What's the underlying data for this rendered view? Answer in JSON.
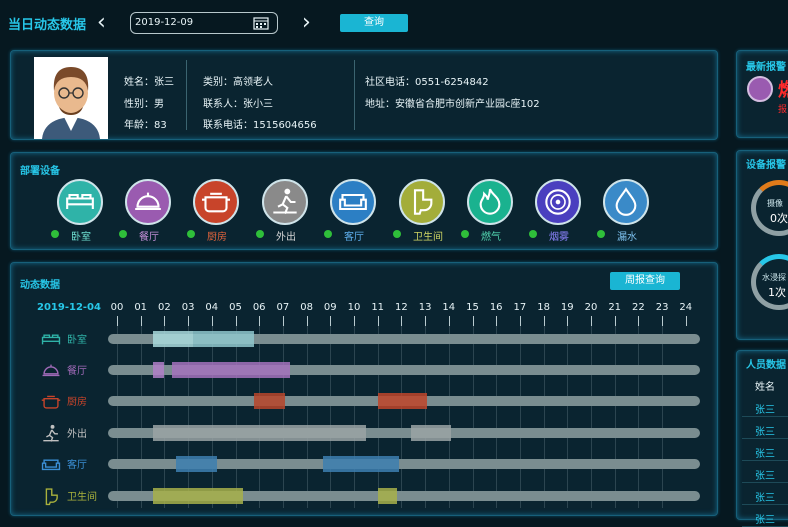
{
  "header": {
    "title": "当日动态数据",
    "date": "2019-12-09",
    "query": "查询"
  },
  "profile": {
    "name": "姓名：张三",
    "gender": "性别：男",
    "age": "年龄：83",
    "category": "类别：高领老人",
    "contact": "联系人：张小三",
    "contact_phone": "联系电话：1515604656",
    "community_phone": "社区电话：0551-6254842",
    "address": "地址：安徽省合肥市创新产业园c座102"
  },
  "devices": {
    "title": "部署设备",
    "items": [
      {
        "label": "卧室",
        "color": "#2fb3a8",
        "icon": "bed-icon",
        "labelColor": "#6fe0d2"
      },
      {
        "label": "餐厅",
        "color": "#9a5bb0",
        "icon": "dining-icon",
        "labelColor": "#c48fd8"
      },
      {
        "label": "厨房",
        "color": "#c8442a",
        "icon": "kitchen-pot-icon",
        "labelColor": "#e0643c"
      },
      {
        "label": "外出",
        "color": "#8a8a8a",
        "icon": "walking-icon",
        "labelColor": "#d6d6d6"
      },
      {
        "label": "客厅",
        "color": "#2c7fc4",
        "icon": "sofa-icon",
        "labelColor": "#5fb0ee"
      },
      {
        "label": "卫生间",
        "color": "#a3ad3a",
        "icon": "toilet-icon",
        "labelColor": "#cfd563"
      },
      {
        "label": "燃气",
        "color": "#1ab28f",
        "icon": "flame-icon",
        "labelColor": "#53d6b0"
      },
      {
        "label": "烟雾",
        "color": "#4a3fbf",
        "icon": "smoke-detector-icon",
        "labelColor": "#8d84ff"
      },
      {
        "label": "漏水",
        "color": "#3a8ac8",
        "icon": "water-drop-icon",
        "labelColor": "#7cc0ee"
      }
    ]
  },
  "dynamic": {
    "title": "动态数据",
    "week_btn": "周报查询",
    "date": "2019-12-04",
    "hours": [
      "00",
      "01",
      "02",
      "03",
      "04",
      "05",
      "06",
      "07",
      "08",
      "09",
      "10",
      "11",
      "12",
      "13",
      "14",
      "15",
      "16",
      "17",
      "18",
      "19",
      "20",
      "21",
      "22",
      "23",
      "24"
    ],
    "rows": [
      {
        "label": "卧室",
        "icon": "bed-icon",
        "color": "#2fb3a8",
        "segs": [
          [
            1.5,
            3.2,
            "#a9d9dc"
          ],
          [
            3.2,
            5.8,
            "#8fc7cc"
          ]
        ]
      },
      {
        "label": "餐厅",
        "icon": "dining-icon",
        "color": "#a06ab8",
        "segs": [
          [
            1.5,
            2.0,
            "#b07fc8"
          ],
          [
            2.3,
            7.3,
            "#a572bd"
          ]
        ]
      },
      {
        "label": "厨房",
        "icon": "kitchen-pot-icon",
        "color": "#c8442a",
        "segs": [
          [
            5.8,
            7.1,
            "#b8452a"
          ],
          [
            11.0,
            13.1,
            "#c0452a"
          ]
        ]
      },
      {
        "label": "外出",
        "icon": "walking-icon",
        "color": "#c0c0c0",
        "segs": [
          [
            1.5,
            10.5,
            "#9aa3a4"
          ],
          [
            12.4,
            14.1,
            "#9aa3a4"
          ]
        ]
      },
      {
        "label": "客厅",
        "icon": "sofa-icon",
        "color": "#3b8fd6",
        "segs": [
          [
            2.5,
            4.2,
            "#3d7fb0"
          ],
          [
            8.7,
            11.9,
            "#3d7fb0"
          ]
        ]
      },
      {
        "label": "卫生间",
        "icon": "toilet-icon",
        "color": "#a9b13c",
        "segs": [
          [
            1.5,
            5.3,
            "#a7b04a"
          ],
          [
            11.0,
            11.8,
            "#a7b04a"
          ]
        ]
      }
    ]
  },
  "right": {
    "alert_title": "最新报警",
    "alert_text": "燃",
    "alert_sub": "报",
    "stats_title": "设备报警",
    "stat1_label": "摄像",
    "stat1_val": "0次",
    "stat2_label": "水浸探",
    "stat2_val": "1次",
    "people_title": "人员数据",
    "name_header": "姓名",
    "names": [
      "张三",
      "张三",
      "张三",
      "张三",
      "张三",
      "张三"
    ]
  }
}
